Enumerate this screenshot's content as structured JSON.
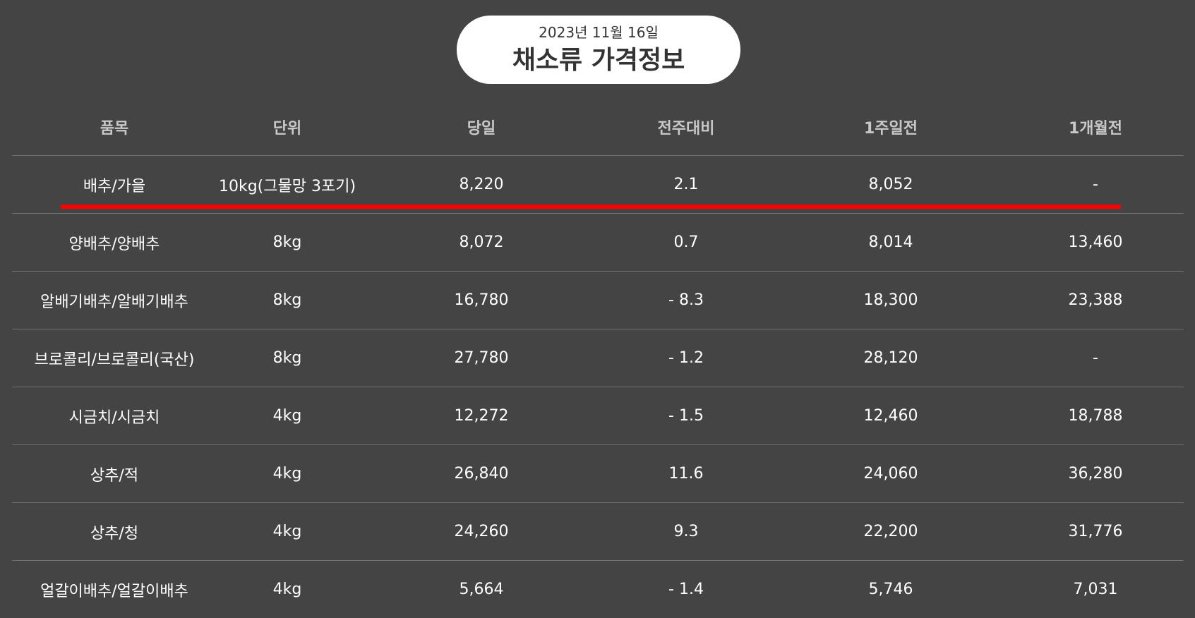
{
  "header": {
    "date": "2023년 11월 16일",
    "title": "채소류 가격정보"
  },
  "table": {
    "columns": [
      "품목",
      "단위",
      "당일",
      "전주대비",
      "1주일전",
      "1개월전"
    ],
    "rows": [
      [
        "배추/가을",
        "10kg(그물망 3포기)",
        "8,220",
        "2.1",
        "8,052",
        "-"
      ],
      [
        "양배추/양배추",
        "8kg",
        "8,072",
        "0.7",
        "8,014",
        "13,460"
      ],
      [
        "알배기배추/알배기배추",
        "8kg",
        "16,780",
        "- 8.3",
        "18,300",
        "23,388"
      ],
      [
        "브로콜리/브로콜리(국산)",
        "8kg",
        "27,780",
        "- 1.2",
        "28,120",
        "-"
      ],
      [
        "시금치/시금치",
        "4kg",
        "12,272",
        "- 1.5",
        "12,460",
        "18,788"
      ],
      [
        "상추/적",
        "4kg",
        "26,840",
        "11.6",
        "24,060",
        "36,280"
      ],
      [
        "상추/청",
        "4kg",
        "24,260",
        "9.3",
        "22,200",
        "31,776"
      ],
      [
        "얼갈이배추/얼갈이배추",
        "4kg",
        "5,664",
        "- 1.4",
        "5,746",
        "7,031"
      ]
    ]
  },
  "colors": {
    "background": "#444444",
    "highlight": "#ff0000",
    "title_bg": "#ffffff"
  }
}
